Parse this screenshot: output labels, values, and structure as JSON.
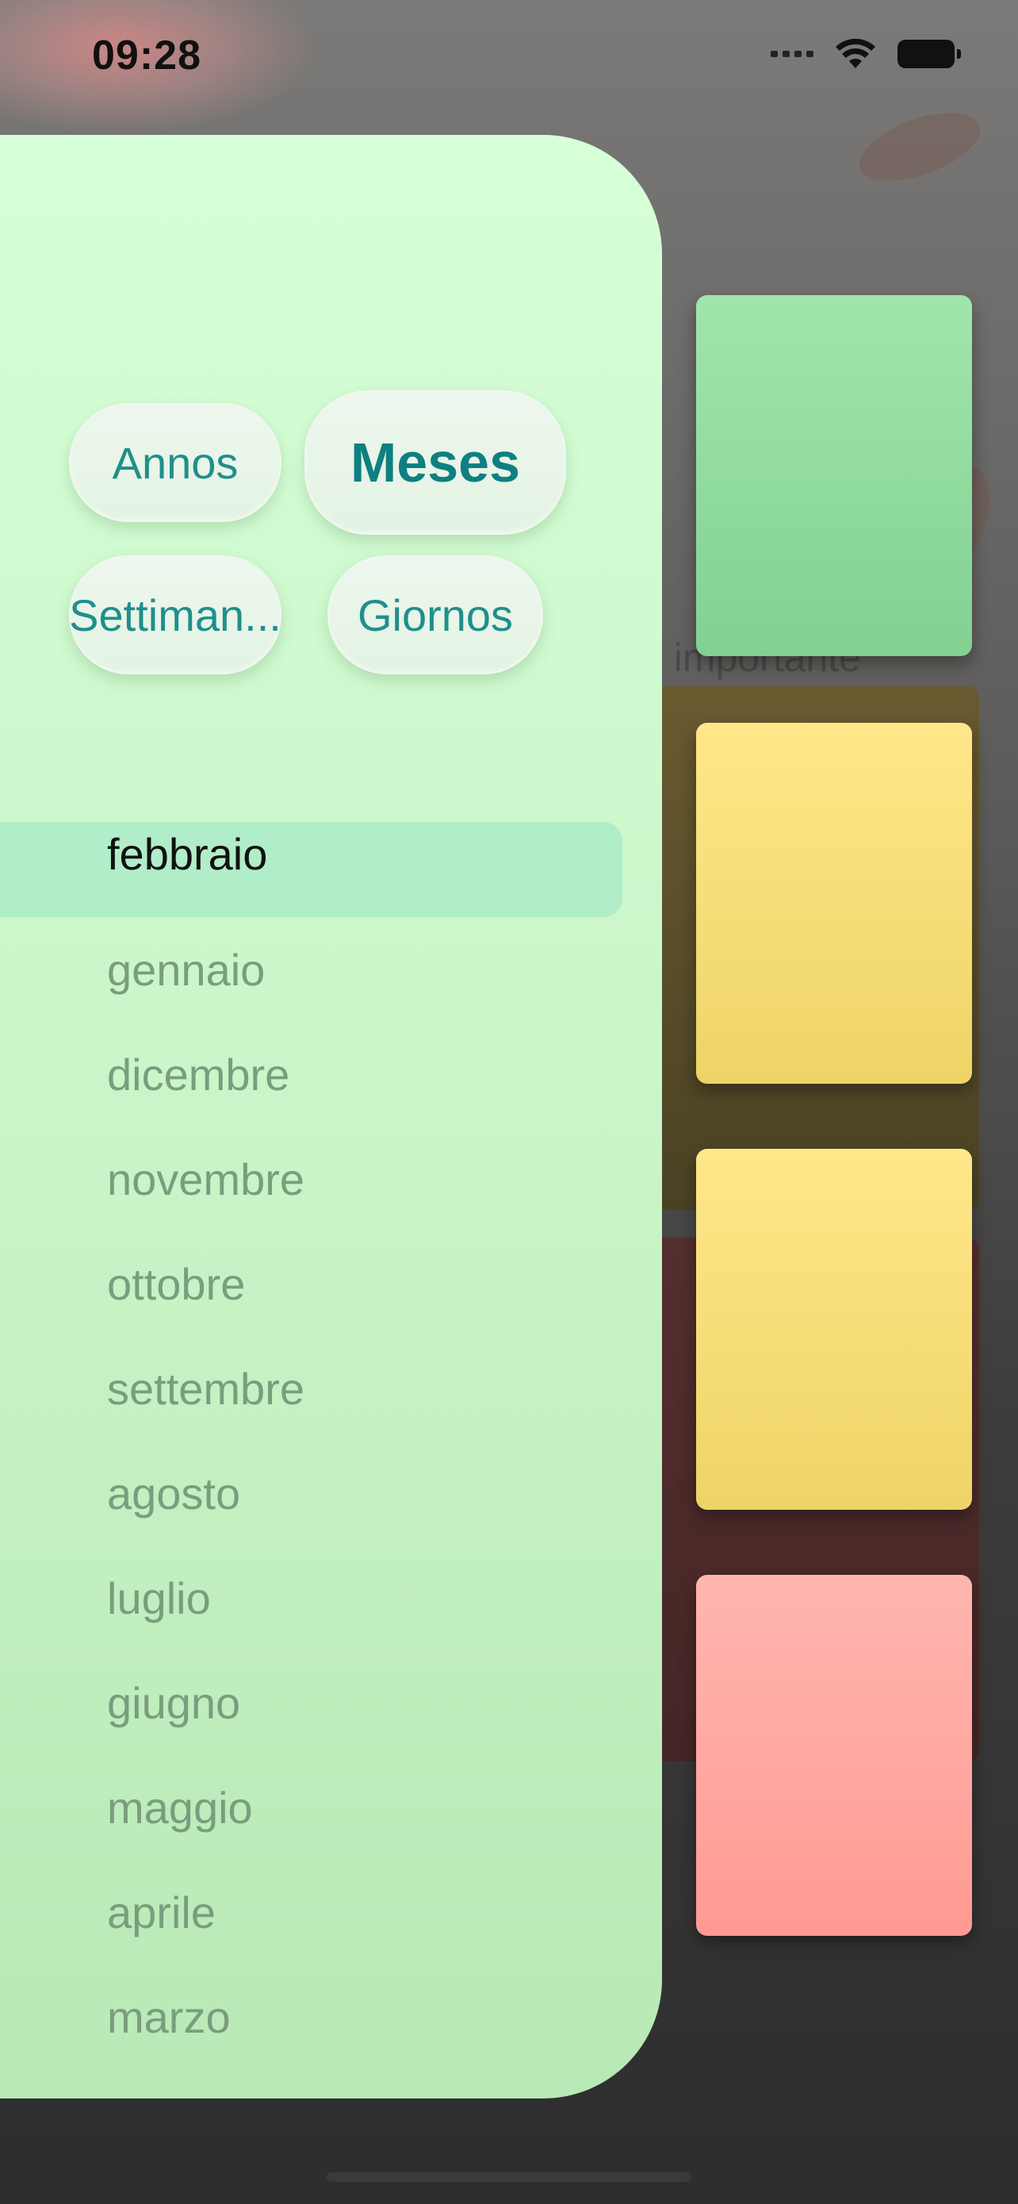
{
  "status_bar": {
    "time": "09:28"
  },
  "background": {
    "partial_text": "n importante",
    "notes": [
      {
        "color": "#8fdc9f"
      },
      {
        "color": "#f8df79"
      },
      {
        "color": "#f8df79"
      },
      {
        "color": "#ffa7a0"
      }
    ]
  },
  "drawer": {
    "segments": [
      {
        "label": "Annos",
        "selected": false
      },
      {
        "label": "Meses",
        "selected": true
      },
      {
        "label": "Settiman...",
        "selected": false
      },
      {
        "label": "Giornos",
        "selected": false
      }
    ],
    "months": [
      {
        "label": "febbraio",
        "selected": true
      },
      {
        "label": "gennaio",
        "selected": false
      },
      {
        "label": "dicembre",
        "selected": false
      },
      {
        "label": "novembre",
        "selected": false
      },
      {
        "label": "ottobre",
        "selected": false
      },
      {
        "label": "settembre",
        "selected": false
      },
      {
        "label": "agosto",
        "selected": false
      },
      {
        "label": "luglio",
        "selected": false
      },
      {
        "label": "giugno",
        "selected": false
      },
      {
        "label": "maggio",
        "selected": false
      },
      {
        "label": "aprile",
        "selected": false
      },
      {
        "label": "marzo",
        "selected": false
      }
    ]
  },
  "colors": {
    "accent": "#0e8082",
    "drawer_top": "#d7ffd8",
    "drawer_bottom": "#b8e9b6",
    "selected_row": "#b0edc8"
  }
}
